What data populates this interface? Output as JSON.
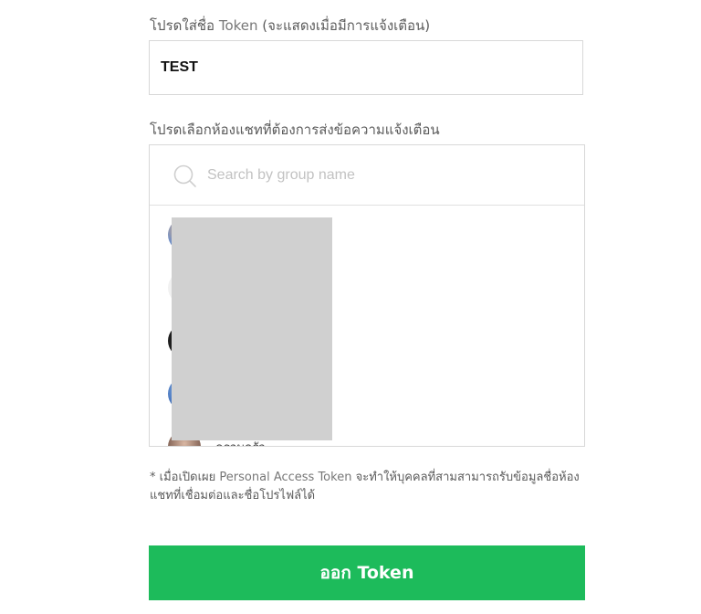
{
  "token_name": {
    "label_prefix": "โปรดใส่ชื่อ",
    "label_token": "Token",
    "label_suffix": "(จะแสดงเมื่อมีการแจ้งเตือน)",
    "value": "TEST"
  },
  "chat_select": {
    "label": "โปรดเลือกห้องแชทที่ต้องการส่งข้อความแจ้งเตือน",
    "search_placeholder": "Search by group name",
    "groups": [
      {
        "name": "",
        "avatar_color": "#5f86c4"
      },
      {
        "name": "",
        "avatar_color": "#eeeeee"
      },
      {
        "name": "",
        "avatar_color": "#1d1d1d"
      },
      {
        "name": "",
        "avatar_color": "#4a78c0"
      },
      {
        "name": "ครอบครัว",
        "avatar_color": "#8a6a5c"
      }
    ]
  },
  "notice": {
    "prefix": "* เมื่อเปิดเผย",
    "highlight": "Personal Access Token",
    "suffix": "จะทำให้บุคคลที่สามสามารถรับข้อมูลชื่อห้องแชทที่เชื่อมต่อและชื่อโปรไฟล์ได้"
  },
  "issue_button": {
    "label": "ออก Token",
    "color": "#1dbb5b"
  }
}
